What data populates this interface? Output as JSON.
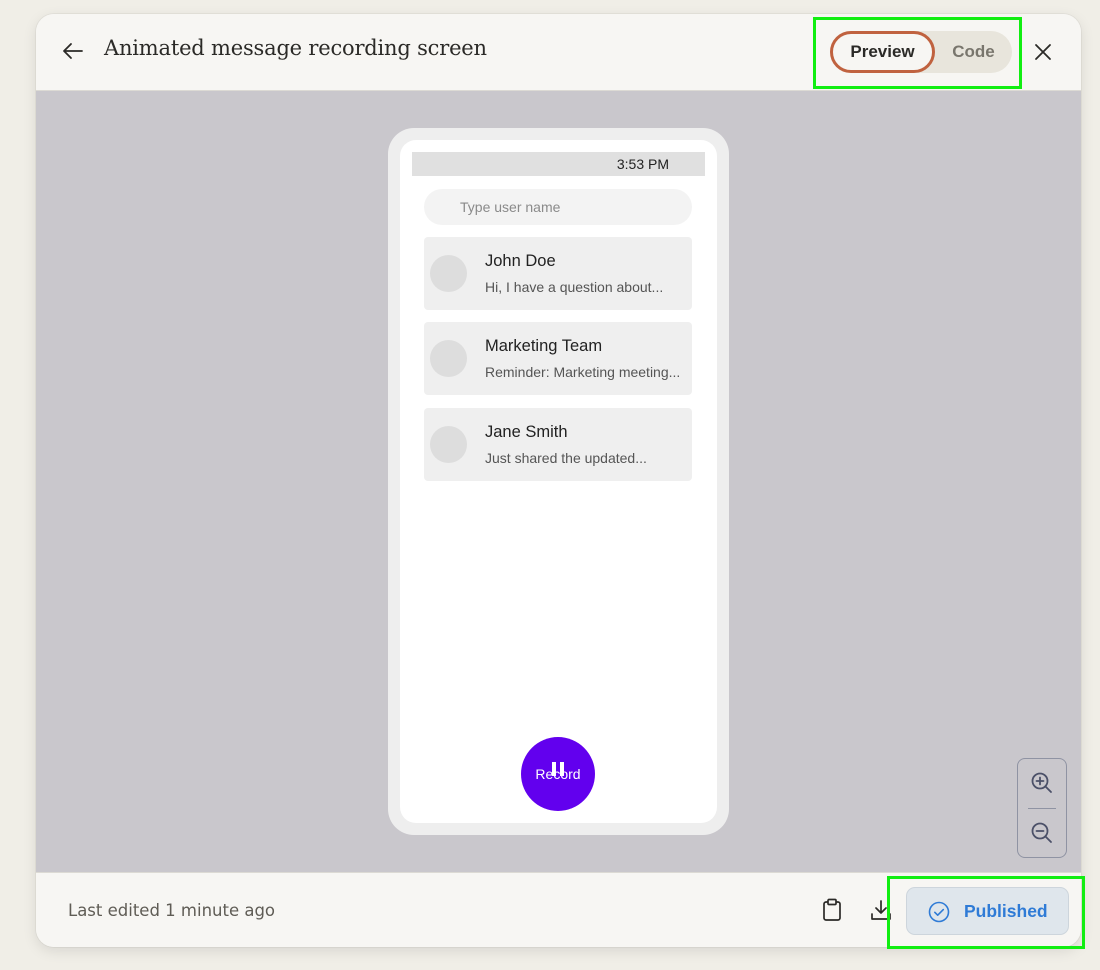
{
  "header": {
    "title": "Animated message recording screen",
    "back_icon": "arrow-left-icon",
    "close_icon": "close-icon",
    "view_toggle": {
      "options": [
        {
          "label": "Preview",
          "selected": true
        },
        {
          "label": "Code",
          "selected": false
        }
      ]
    }
  },
  "preview": {
    "status_bar": {
      "time": "3:53 PM"
    },
    "search": {
      "placeholder": "Type user name",
      "value": ""
    },
    "chats": [
      {
        "name": "John Doe",
        "message": "Hi, I have a question about..."
      },
      {
        "name": "Marketing Team",
        "message": "Reminder: Marketing meeting..."
      },
      {
        "name": "Jane Smith",
        "message": "Just shared the updated..."
      }
    ],
    "record_button": {
      "label": "Record",
      "icon": "pause-icon",
      "color": "#6200ee"
    }
  },
  "zoom_controls": {
    "zoom_in_icon": "zoom-in-icon",
    "zoom_out_icon": "zoom-out-icon"
  },
  "footer": {
    "last_edited": "Last edited 1 minute ago",
    "copy_icon": "clipboard-icon",
    "download_icon": "download-icon",
    "publish": {
      "label": "Published",
      "icon": "check-circle-icon",
      "color": "#2f7bd6"
    }
  },
  "colors": {
    "accent_selected_border": "#c0623f",
    "highlight": "#11ee11"
  }
}
